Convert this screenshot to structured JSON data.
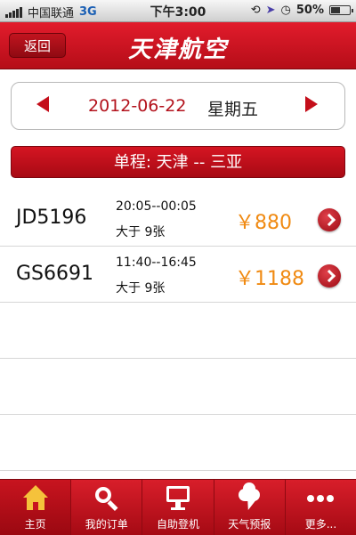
{
  "status": {
    "carrier": "中国联通",
    "network": "3G",
    "time": "下午3:00",
    "battery": "50%",
    "battery_level": 0.5,
    "icons": [
      "signal-icon",
      "lock-rotation-icon",
      "location-icon",
      "alarm-icon",
      "battery-icon"
    ]
  },
  "header": {
    "back_label": "返回",
    "title": "天津航空"
  },
  "date_selector": {
    "date": "2012-06-22",
    "weekday": "星期五"
  },
  "route": {
    "text": "单程:  天津 -- 三亚"
  },
  "flights": [
    {
      "number": "JD5196",
      "times": "20:05--00:05",
      "seats": "大于 9张",
      "price": "￥880"
    },
    {
      "number": "GS6691",
      "times": "11:40--16:45",
      "seats": "大于 9张",
      "price": "￥1188"
    }
  ],
  "tabs": [
    {
      "label": "主页",
      "icon": "home-icon"
    },
    {
      "label": "我的订单",
      "icon": "search-icon"
    },
    {
      "label": "自助登机",
      "icon": "monitor-icon"
    },
    {
      "label": "天气预报",
      "icon": "weather-icon"
    },
    {
      "label": "更多...",
      "icon": "more-icon"
    }
  ],
  "colors": {
    "brand_red": "#c40e1a",
    "price_orange": "#f08a12",
    "home_icon": "#f5c23b"
  }
}
